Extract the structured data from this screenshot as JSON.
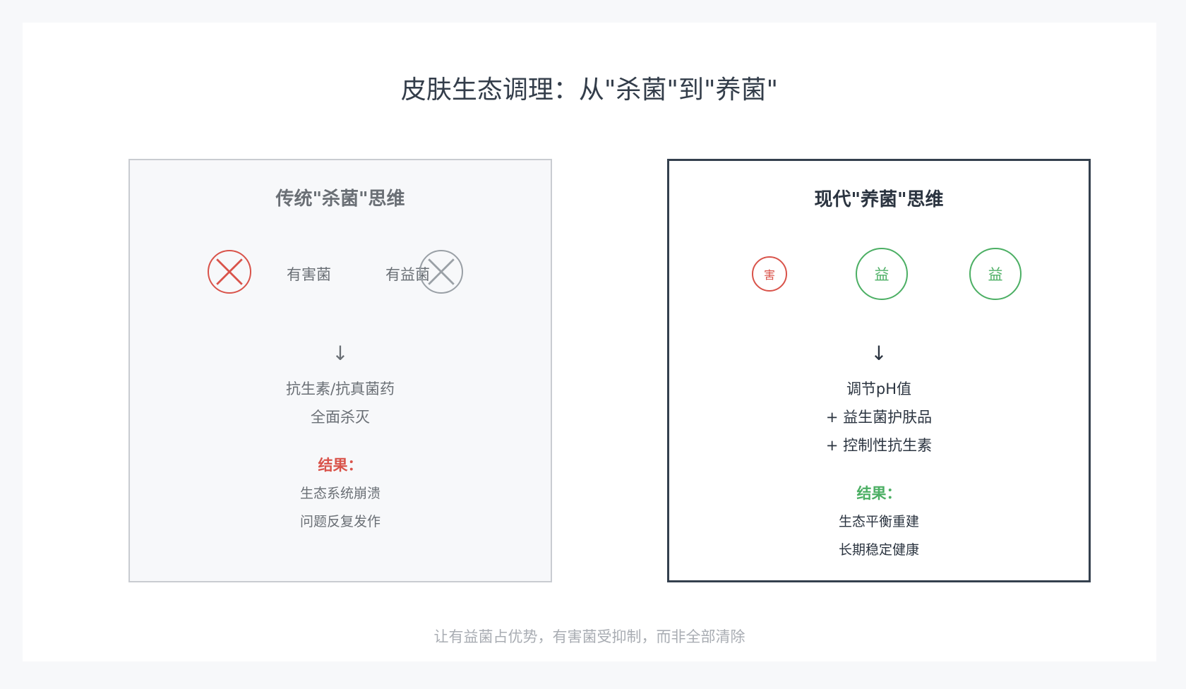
{
  "title": "皮肤生态调理：从\"杀菌\"到\"养菌\"",
  "left": {
    "title": "传统\"杀菌\"思维",
    "harmful_label": "有害菌",
    "beneficial_label": "有益菌",
    "arrow": "↓",
    "method_line1": "抗生素/抗真菌药",
    "method_line2": "全面杀灭",
    "result_label": "结果：",
    "result_line1": "生态系统崩溃",
    "result_line2": "问题反复发作"
  },
  "right": {
    "title": "现代\"养菌\"思维",
    "harmful_char": "害",
    "beneficial_char_1": "益",
    "beneficial_char_2": "益",
    "arrow": "↓",
    "method_line1": "调节pH值",
    "method_line2": "+ 益生菌护肤品",
    "method_line3": "+ 控制性抗生素",
    "result_label": "结果：",
    "result_line1": "生态平衡重建",
    "result_line2": "长期稳定健康"
  },
  "footer": "让有益菌占优势，有害菌受抑制，而非全部清除",
  "colors": {
    "red": "#d9534a",
    "green": "#4caf64",
    "gray": "#9aa0a6",
    "dark": "#34404e"
  }
}
